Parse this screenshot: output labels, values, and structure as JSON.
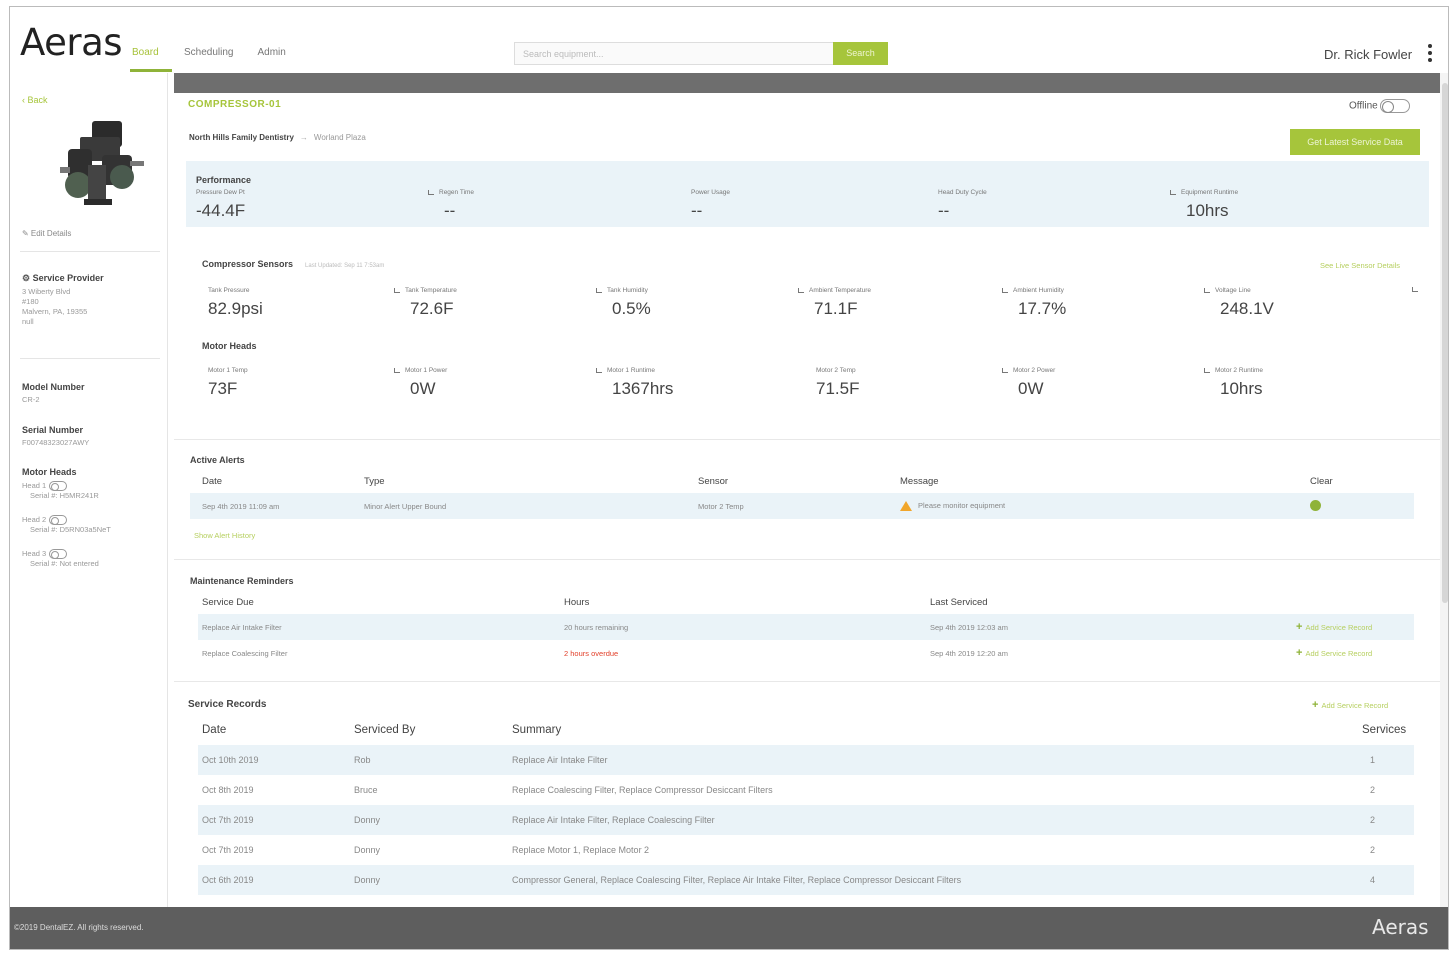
{
  "header": {
    "logo": "Aeras",
    "nav": [
      "Board",
      "Scheduling",
      "Admin"
    ],
    "search_placeholder": "Search equipment...",
    "search_label": "Search",
    "user": "Dr. Rick Fowler"
  },
  "sidebar": {
    "back": "‹ Back",
    "edit": "✎ Edit Details",
    "service_provider_title": "Service Provider",
    "service_provider_lines": [
      "3 Wiberty Blvd",
      "#180",
      "Malvern, PA, 19355",
      "null"
    ],
    "model_title": "Model Number",
    "model_value": "CR-2",
    "serial_title": "Serial Number",
    "serial_value": "F00748323027AWY",
    "motor_heads_title": "Motor Heads",
    "heads": [
      {
        "label": "Head 1",
        "serial": "Serial #: H5MR241R"
      },
      {
        "label": "Head 2",
        "serial": "Serial #: D5RN03a5NeT"
      },
      {
        "label": "Head 3",
        "serial": "Serial #: Not entered"
      }
    ]
  },
  "device": {
    "name": "COMPRESSOR-01",
    "offline_label": "Offline",
    "practice": "North Hills Family Dentistry",
    "location": "Worland Plaza",
    "get_button": "Get Latest Service Data"
  },
  "performance": {
    "title": "Performance",
    "metrics": [
      {
        "label": "Pressure Dew Pt",
        "value": "-44.4F"
      },
      {
        "label": "Regen Time",
        "value": "--"
      },
      {
        "label": "Power Usage",
        "value": "--"
      },
      {
        "label": "Head Duty Cycle",
        "value": "--"
      },
      {
        "label": "Equipment Runtime",
        "value": "10hrs"
      }
    ]
  },
  "compressor_sensors": {
    "title": "Compressor Sensors",
    "note": "Last Updated: Sep 11 7:53am",
    "link": "See Live Sensor Details",
    "metrics": [
      {
        "label": "Tank Pressure",
        "value": "82.9psi"
      },
      {
        "label": "Tank Temperature",
        "value": "72.6F"
      },
      {
        "label": "Tank Humidity",
        "value": "0.5%"
      },
      {
        "label": "Ambient Temperature",
        "value": "71.1F"
      },
      {
        "label": "Ambient Humidity",
        "value": "17.7%"
      },
      {
        "label": "Voltage Line",
        "value": "248.1V"
      }
    ]
  },
  "motor_heads": {
    "title": "Motor Heads",
    "metrics": [
      {
        "label": "Motor 1 Temp",
        "value": "73F"
      },
      {
        "label": "Motor 1 Power",
        "value": "0W"
      },
      {
        "label": "Motor 1 Runtime",
        "value": "1367hrs"
      },
      {
        "label": "Motor 2 Temp",
        "value": "71.5F"
      },
      {
        "label": "Motor 2 Power",
        "value": "0W"
      },
      {
        "label": "Motor 2 Runtime",
        "value": "10hrs"
      }
    ]
  },
  "alerts": {
    "title": "Active Alerts",
    "columns": [
      "Date",
      "Type",
      "Sensor",
      "Message",
      "Clear"
    ],
    "rows": [
      {
        "date": "Sep 4th 2019 11:09 am",
        "type": "Minor Alert Upper Bound",
        "sensor": "Motor 2 Temp",
        "message": "Please monitor equipment"
      }
    ],
    "history_link": "Show Alert History"
  },
  "maintenance": {
    "title": "Maintenance Reminders",
    "columns": [
      "Service Due",
      "Hours",
      "Last Serviced"
    ],
    "rows": [
      {
        "service": "Replace Air Intake Filter",
        "hours": "20 hours remaining",
        "last": "Sep 4th 2019 12:03 am",
        "action": "Add Service Record"
      },
      {
        "service": "Replace Coalescing Filter",
        "hours": "2 hours overdue",
        "last": "Sep 4th 2019 12:20 am",
        "action": "Add Service Record"
      }
    ]
  },
  "records": {
    "title": "Service Records",
    "add_link": "Add Service Record",
    "columns": [
      "Date",
      "Serviced By",
      "Summary",
      "Services"
    ],
    "rows": [
      {
        "date": "Oct 10th 2019",
        "by": "Rob",
        "summary": "Replace Air Intake Filter",
        "services": "1"
      },
      {
        "date": "Oct 8th 2019",
        "by": "Bruce",
        "summary": "Replace Coalescing Filter, Replace Compressor Desiccant Filters",
        "services": "2"
      },
      {
        "date": "Oct 7th 2019",
        "by": "Donny",
        "summary": "Replace Air Intake Filter, Replace Coalescing Filter",
        "services": "2"
      },
      {
        "date": "Oct 7th 2019",
        "by": "Donny",
        "summary": "Replace Motor 1, Replace Motor 2",
        "services": "2"
      },
      {
        "date": "Oct 6th 2019",
        "by": "Donny",
        "summary": "Compressor General, Replace Coalescing Filter, Replace Air Intake Filter, Replace Compressor Desiccant Filters",
        "services": "4"
      }
    ]
  },
  "footer": {
    "copyright": "©2019 DentalEZ. All rights reserved.",
    "logo": "Aeras"
  },
  "colors": {
    "accent": "#a6c53b",
    "panel": "#eaf3f8",
    "topbar": "#6e6e6e",
    "footer": "#5e5e5e",
    "alert": "#f1a62b",
    "danger": "#e2412b"
  }
}
